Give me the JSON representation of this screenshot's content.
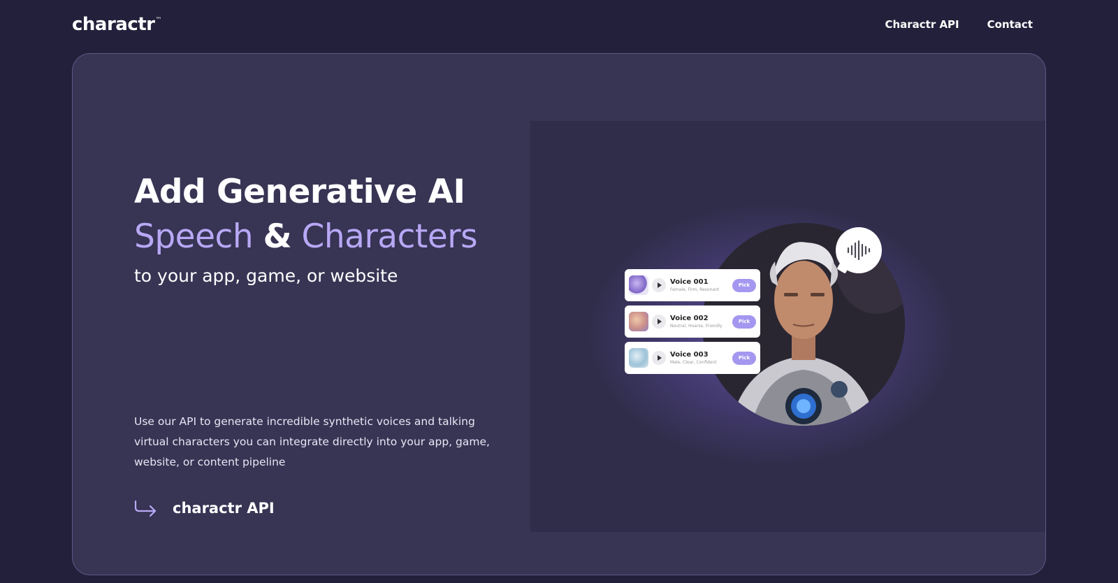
{
  "header": {
    "logo": "charactr",
    "logo_mark": "™",
    "nav": [
      {
        "label": "Charactr API"
      },
      {
        "label": "Contact"
      }
    ]
  },
  "hero": {
    "line1": "Add Generative AI",
    "line2_a": "Speech",
    "line2_amp": "&",
    "line2_b": "Characters",
    "subtitle": "to your app, game, or website",
    "description": "Use our API to generate incredible synthetic voices and talking virtual characters you can integrate directly into your app, game, website, or content pipeline",
    "cta_label": "charactr API"
  },
  "voices": [
    {
      "name": "Voice 001",
      "tags": "Female, Firm, Resonant",
      "pick": "Pick",
      "color": "#a58fd8"
    },
    {
      "name": "Voice 002",
      "tags": "Neutral, Hoarse, Friendly",
      "pick": "Pick",
      "color": "#d9a383"
    },
    {
      "name": "Voice 003",
      "tags": "Male, Clear, Confident",
      "pick": "Pick",
      "color": "#9ec3d8"
    }
  ],
  "icons": {
    "cta_arrow": "arrow-right-icon",
    "waveform": "waveform-icon",
    "play": "play-icon"
  },
  "colors": {
    "background": "#22203a",
    "card": "#373454",
    "accent": "#b8a8f5",
    "pick_button": "#a397f0"
  }
}
